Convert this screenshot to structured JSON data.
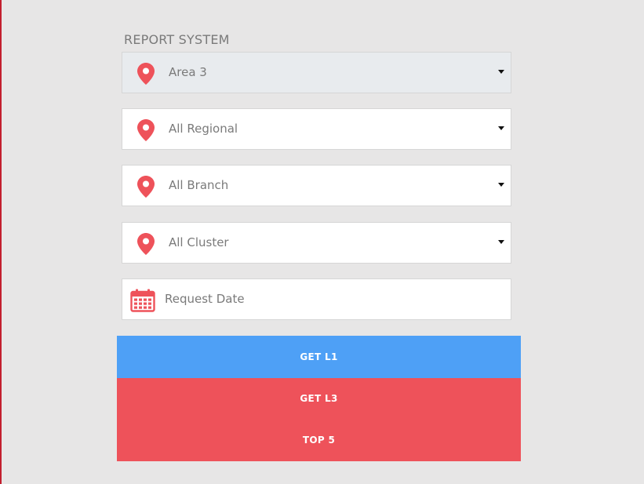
{
  "header": {
    "title": "REPORT SYSTEM"
  },
  "filters": [
    {
      "label": "Area 3",
      "icon": "location-pin-icon"
    },
    {
      "label": "All Regional",
      "icon": "location-pin-icon"
    },
    {
      "label": "All Branch",
      "icon": "location-pin-icon"
    },
    {
      "label": "All Cluster",
      "icon": "location-pin-icon"
    }
  ],
  "date_field": {
    "placeholder": "Request Date",
    "icon": "calendar-icon"
  },
  "buttons": {
    "get_l1": "GET L1",
    "get_l3": "GET L3",
    "top5": "TOP 5"
  },
  "colors": {
    "accent_red": "#ee525a",
    "accent_blue": "#4ea0f6",
    "background": "#e7e6e6"
  }
}
